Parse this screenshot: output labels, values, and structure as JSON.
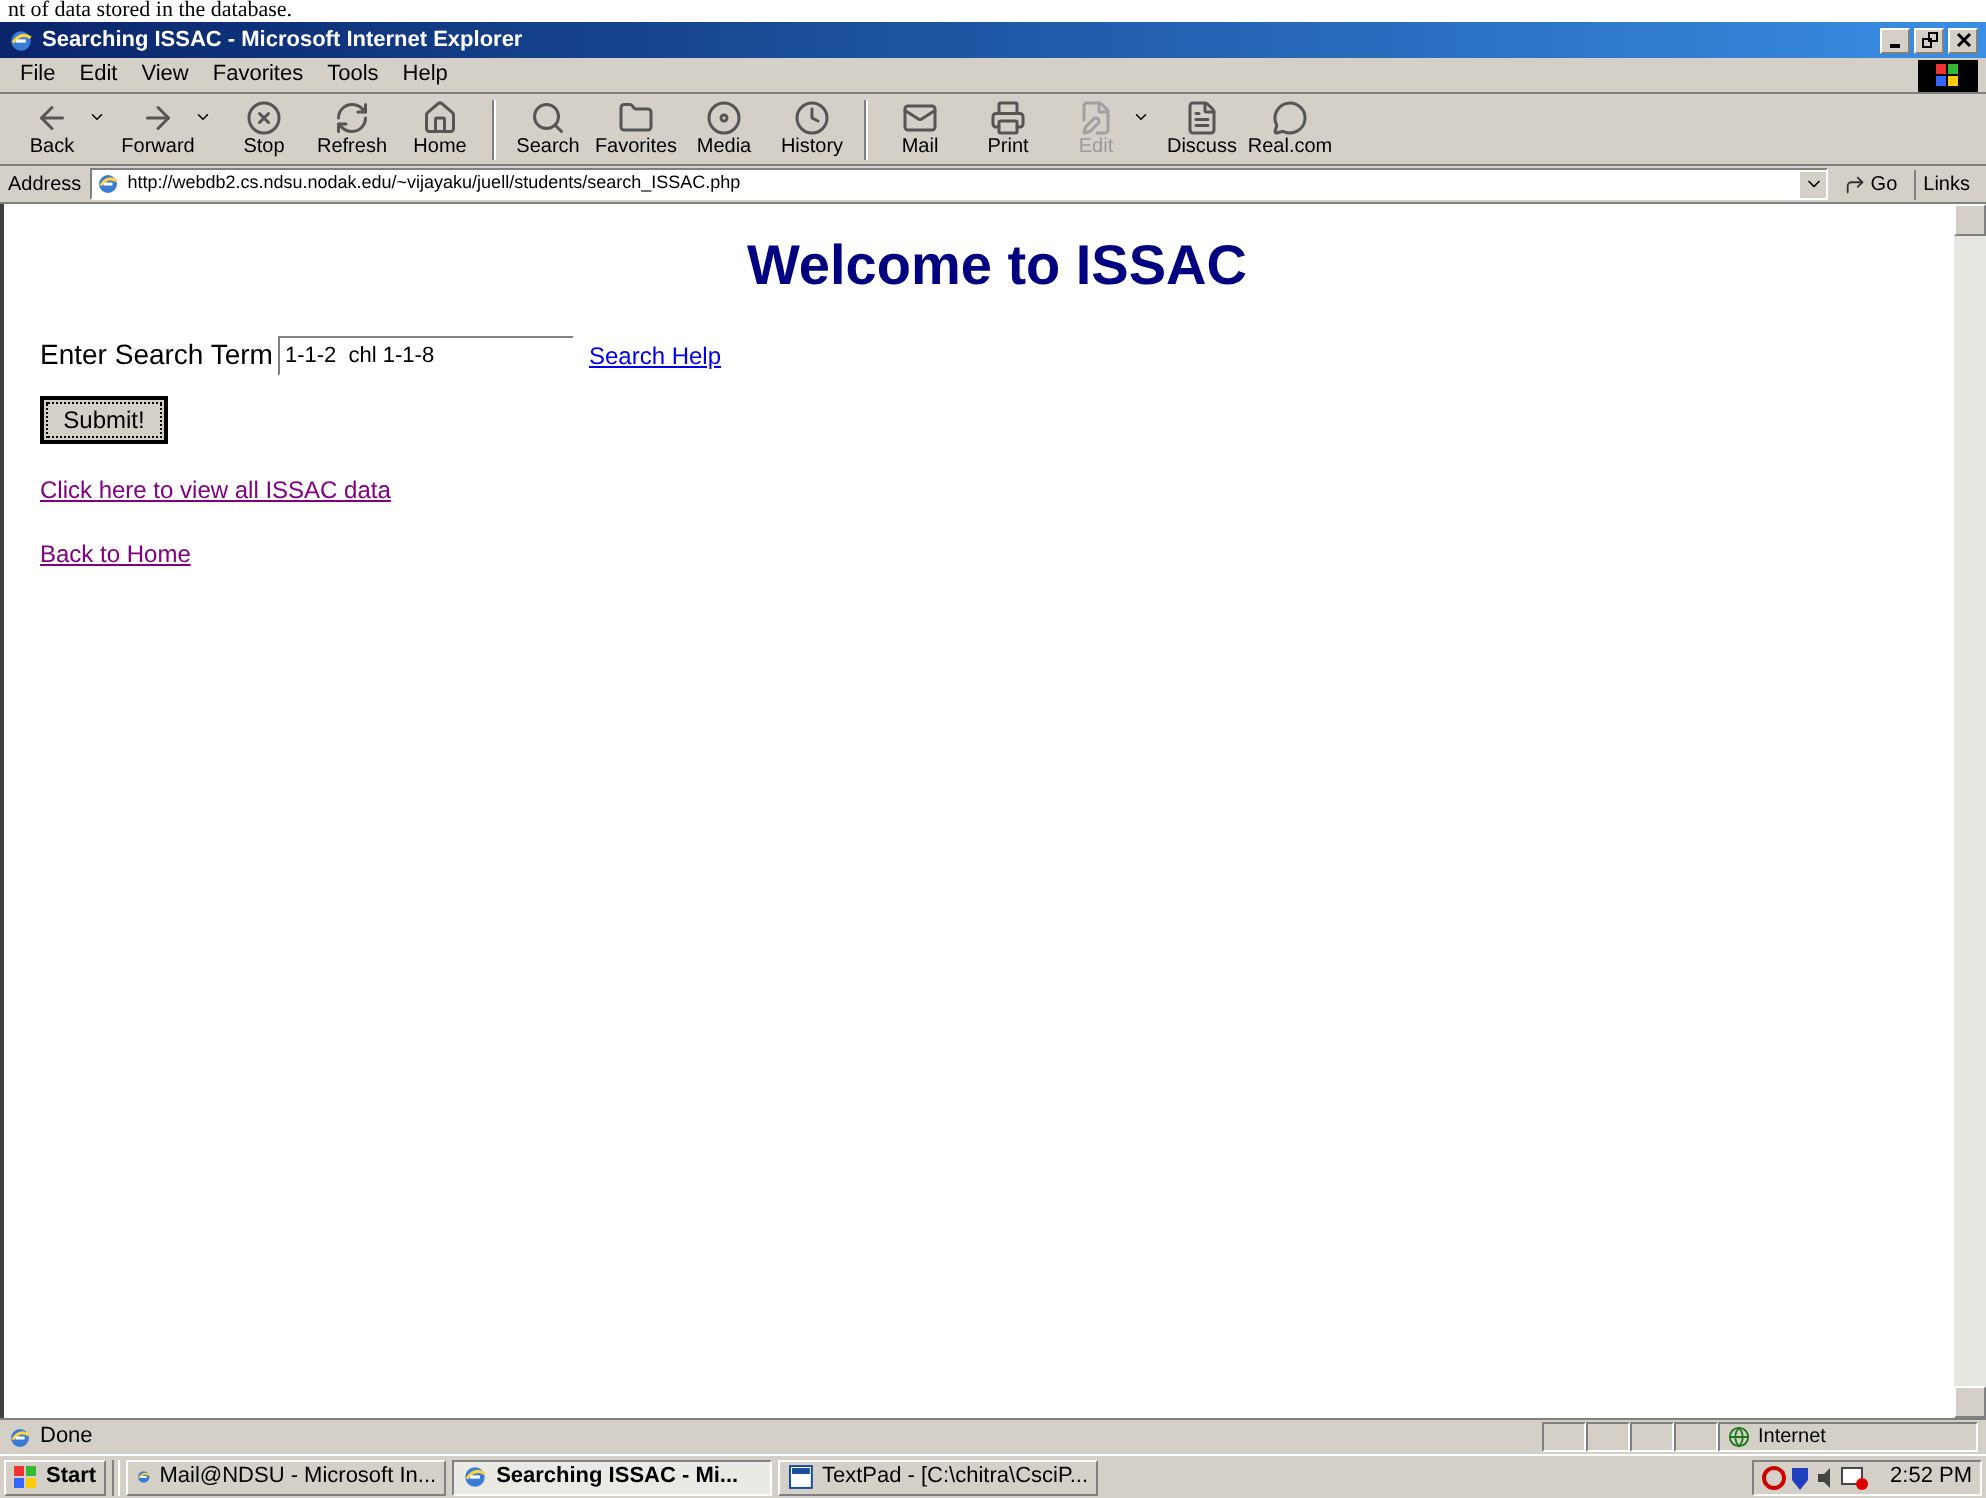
{
  "document_text": "nt of data stored in the database.",
  "window": {
    "title": "Searching ISSAC - Microsoft Internet Explorer"
  },
  "menu": [
    {
      "label": "File"
    },
    {
      "label": "Edit"
    },
    {
      "label": "View"
    },
    {
      "label": "Favorites"
    },
    {
      "label": "Tools"
    },
    {
      "label": "Help"
    }
  ],
  "toolbar": [
    {
      "label": "Back",
      "kind": "back",
      "dropdown": true,
      "disabled": false
    },
    {
      "label": "Forward",
      "kind": "forward",
      "dropdown": true,
      "disabled": false
    },
    {
      "label": "Stop",
      "kind": "stop",
      "dropdown": false,
      "disabled": false
    },
    {
      "label": "Refresh",
      "kind": "refresh",
      "dropdown": false,
      "disabled": false
    },
    {
      "label": "Home",
      "kind": "home",
      "dropdown": false,
      "disabled": false
    },
    {
      "label": "Search",
      "kind": "search",
      "dropdown": false,
      "disabled": false,
      "separator_before": true
    },
    {
      "label": "Favorites",
      "kind": "favorites",
      "dropdown": false,
      "disabled": false
    },
    {
      "label": "Media",
      "kind": "media",
      "dropdown": false,
      "disabled": false
    },
    {
      "label": "History",
      "kind": "history",
      "dropdown": false,
      "disabled": false
    },
    {
      "label": "Mail",
      "kind": "mail",
      "dropdown": false,
      "disabled": false,
      "separator_before": true
    },
    {
      "label": "Print",
      "kind": "print",
      "dropdown": false,
      "disabled": false
    },
    {
      "label": "Edit",
      "kind": "edit",
      "dropdown": true,
      "disabled": true
    },
    {
      "label": "Discuss",
      "kind": "discuss",
      "dropdown": false,
      "disabled": false
    },
    {
      "label": "Real.com",
      "kind": "real",
      "dropdown": false,
      "disabled": false
    }
  ],
  "address": {
    "label": "Address",
    "value": "http://webdb2.cs.ndsu.nodak.edu/~vijayaku/juell/students/search_ISSAC.php",
    "go": "Go",
    "links": "Links"
  },
  "page": {
    "heading": "Welcome to ISSAC",
    "search_label": "Enter Search Term",
    "search_value": "1-1-2  chl 1-1-8",
    "help_link": {
      "label": "Search Help",
      "visited": false
    },
    "submit": "Submit!",
    "links": [
      {
        "label": "Click here to view all ISSAC data",
        "visited": true
      },
      {
        "label": "Back to Home",
        "visited": true
      }
    ]
  },
  "status_bar": {
    "text": "Done",
    "zone": "Internet"
  },
  "taskbar": {
    "start": "Start",
    "items": [
      {
        "label": "Mail@NDSU - Microsoft In...",
        "kind": "ie",
        "selected": false
      },
      {
        "label": "Searching ISSAC - Mi...",
        "kind": "ie",
        "selected": true
      },
      {
        "label": "TextPad - [C:\\chitra\\CsciP...",
        "kind": "textpad",
        "selected": false
      }
    ],
    "clock": "2:52 PM"
  }
}
